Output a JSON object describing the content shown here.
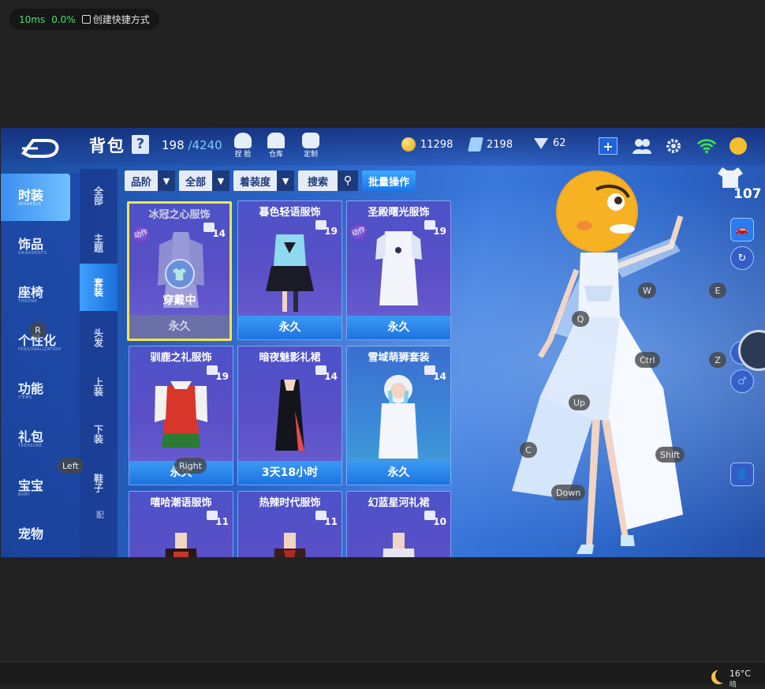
{
  "overlay": {
    "ms": "10ms",
    "pct": "0.0%",
    "shortcut": "创建快捷方式"
  },
  "topbar": {
    "title": "背包",
    "help": "?",
    "capacity_used": "198",
    "capacity_total": "/4240",
    "icons": [
      {
        "label": "捏 脸",
        "icon": "face-icon"
      },
      {
        "label": "仓库",
        "icon": "warehouse-icon"
      },
      {
        "label": "定制",
        "icon": "custom-icon"
      }
    ],
    "coins": "11298",
    "tickets": "2198",
    "diamonds": "62"
  },
  "left_nav": [
    {
      "zh": "时装",
      "en": "APPARELS"
    },
    {
      "zh": "饰品",
      "en": "ORNAMENTS"
    },
    {
      "zh": "座椅",
      "en": "THRONE"
    },
    {
      "zh": "个性化",
      "en": "PERSONALIZATION"
    },
    {
      "zh": "功能",
      "en": "ITEMS"
    },
    {
      "zh": "礼包",
      "en": "TREASURE"
    },
    {
      "zh": "宝宝",
      "en": "BABY"
    },
    {
      "zh": "宠物",
      "en": ""
    }
  ],
  "sub_nav": [
    "全部",
    "主题",
    "套装",
    "头发",
    "上装",
    "下装",
    "鞋子",
    "配"
  ],
  "filters": {
    "rank": "品阶",
    "all": "全部",
    "wear": "着装度",
    "search": "搜索",
    "batch": "批量操作"
  },
  "items": [
    {
      "name": "冰冠之心服饰",
      "level": "14",
      "status": "永久",
      "tag": "动作",
      "wearing": "穿戴中"
    },
    {
      "name": "暮色轻语服饰",
      "level": "19",
      "status": "永久",
      "tag": ""
    },
    {
      "name": "圣殿曙光服饰",
      "level": "19",
      "status": "永久",
      "tag": "动作"
    },
    {
      "name": "驯鹿之礼服饰",
      "level": "19",
      "status": "永久",
      "tag": ""
    },
    {
      "name": "暗夜魅影礼裙",
      "level": "14",
      "status": "3天18小时",
      "tag": ""
    },
    {
      "name": "雪域萌狮套装",
      "level": "14",
      "status": "永久",
      "tag": ""
    },
    {
      "name": "嘻哈潮语服饰",
      "level": "11",
      "status": "",
      "tag": ""
    },
    {
      "name": "热辣时代服饰",
      "level": "11",
      "status": "",
      "tag": ""
    },
    {
      "name": "幻蓝星河礼裙",
      "level": "10",
      "status": "",
      "tag": ""
    }
  ],
  "right_panel": {
    "score": "107"
  },
  "keys": [
    "R",
    "Q",
    "W",
    "E",
    "Ctrl",
    "Z",
    "Up",
    "C",
    "Shift",
    "Down",
    "Left",
    "Right"
  ],
  "taskbar": {
    "temp": "16°C",
    "weather": "晴"
  },
  "colors": {
    "accent": "#1c73e0",
    "selected": "#f4e64a",
    "bg": "#2a62c4"
  }
}
